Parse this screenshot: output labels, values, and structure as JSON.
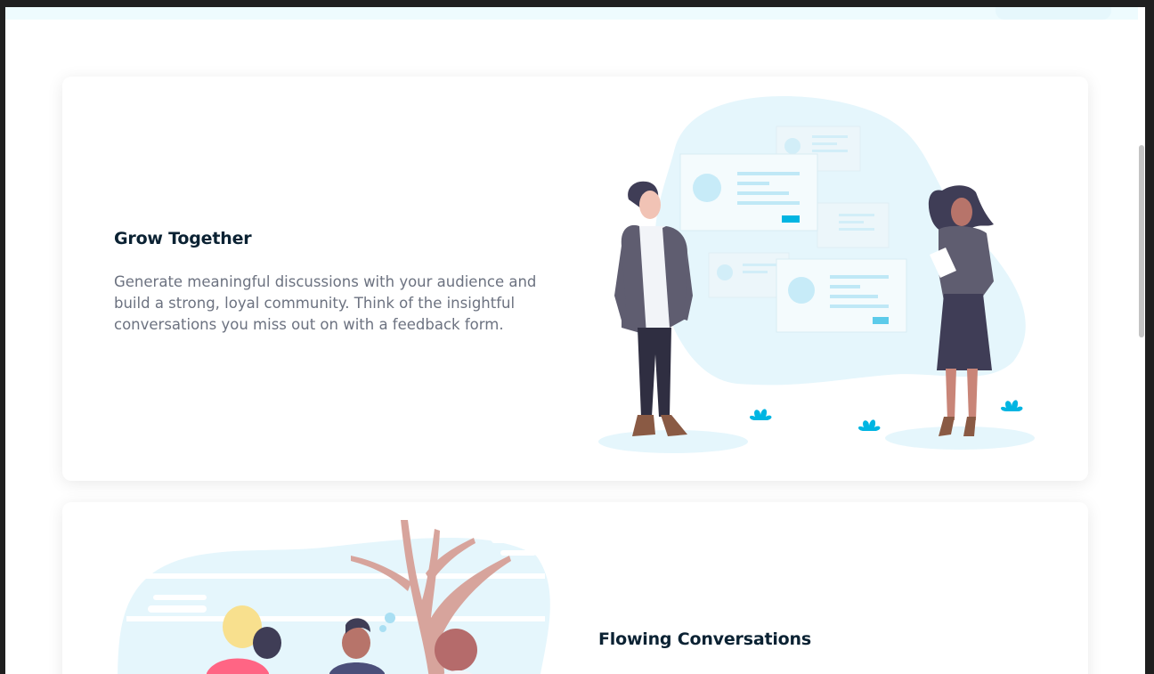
{
  "features": [
    {
      "title": "Grow Together",
      "description": "Generate meaningful discussions with your audience and build a strong, loyal community. Think of the insightful conversations you miss out on with a feedback form."
    },
    {
      "title": "Flowing Conversations"
    }
  ],
  "colors": {
    "heading": "#0b2233",
    "body_text": "#6c7280",
    "accent_cyan": "#00b5e2",
    "blob": "#e5f6fc"
  }
}
